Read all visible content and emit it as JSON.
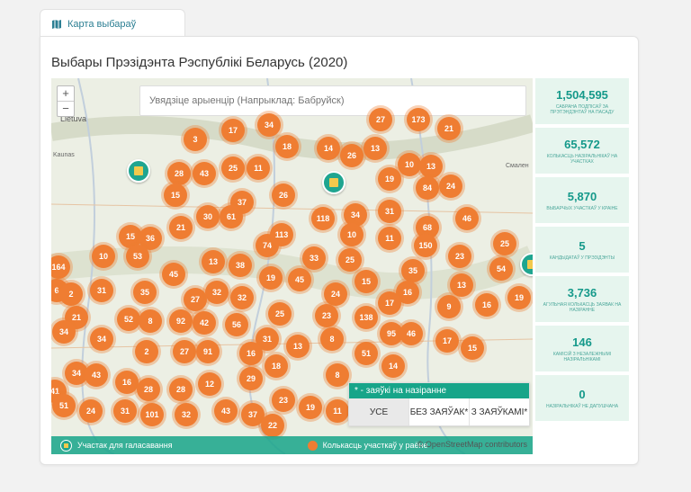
{
  "tab": {
    "label": "Карта выбараў"
  },
  "page": {
    "title": "Выбары Прэзідэнта Рэспублікі Беларусь (2020)"
  },
  "map": {
    "zoom_in": "+",
    "zoom_out": "−",
    "search_placeholder": "Увядзіце арыенцір (Напрыклад: Бабруйск)",
    "place_labels": [
      "Lietuva",
      "Kaunas",
      "Смален"
    ],
    "clusters": [
      "3",
      "17",
      "34",
      "18",
      "14",
      "26",
      "13",
      "27",
      "173",
      "21",
      "28",
      "43",
      "25",
      "11",
      "19",
      "10",
      "13",
      "15",
      "37",
      "26",
      "84",
      "24",
      "30",
      "61",
      "34",
      "118",
      "31",
      "46",
      "21",
      "10",
      "11",
      "68",
      "150",
      "25",
      "15",
      "36",
      "74",
      "113",
      "53",
      "164",
      "10",
      "13",
      "38",
      "33",
      "25",
      "23",
      "35",
      "54",
      "6",
      "31",
      "45",
      "19",
      "45",
      "15",
      "16",
      "13",
      "2",
      "21",
      "35",
      "27",
      "32",
      "32",
      "24",
      "17",
      "19",
      "16",
      "52",
      "8",
      "92",
      "42",
      "56",
      "25",
      "23",
      "138",
      "9",
      "34",
      "34",
      "2",
      "27",
      "91",
      "31",
      "13",
      "8",
      "95",
      "46",
      "17",
      "15",
      "16",
      "18",
      "51",
      "14",
      "34",
      "43",
      "16",
      "28",
      "28",
      "12",
      "29",
      "8",
      "41",
      "51",
      "24",
      "31",
      "101",
      "32",
      "43",
      "37",
      "23",
      "19",
      "11",
      "22"
    ],
    "legend_polling": "Участак для галасавання",
    "legend_count": "Колькасць участкаў у раёне",
    "attribution": "© OpenStreetMap contributors"
  },
  "filter": {
    "header": "* - заяўкі на назіранне",
    "options": [
      "УСЕ",
      "БЕЗ ЗАЯЎАК*",
      "З ЗАЯЎКАМІ*"
    ],
    "selected": "УСЕ"
  },
  "stats": [
    {
      "value": "1,504,595",
      "label": "Сабрана подпісаў за прэтэндэнтаў на пасаду"
    },
    {
      "value": "65,572",
      "label": "Колькасць назіральнікаў на участках"
    },
    {
      "value": "5,870",
      "label": "Выбарчых участкаў у краіне"
    },
    {
      "value": "5",
      "label": "Кандыдатаў у прэзідэнты"
    },
    {
      "value": "3,736",
      "label": "Агульная колькасць заявак на назіранне"
    },
    {
      "value": "146",
      "label": "Камісій з незалежнымі назіральнікамі"
    },
    {
      "value": "0",
      "label": "Назіральнікаў не дапушчана"
    }
  ]
}
